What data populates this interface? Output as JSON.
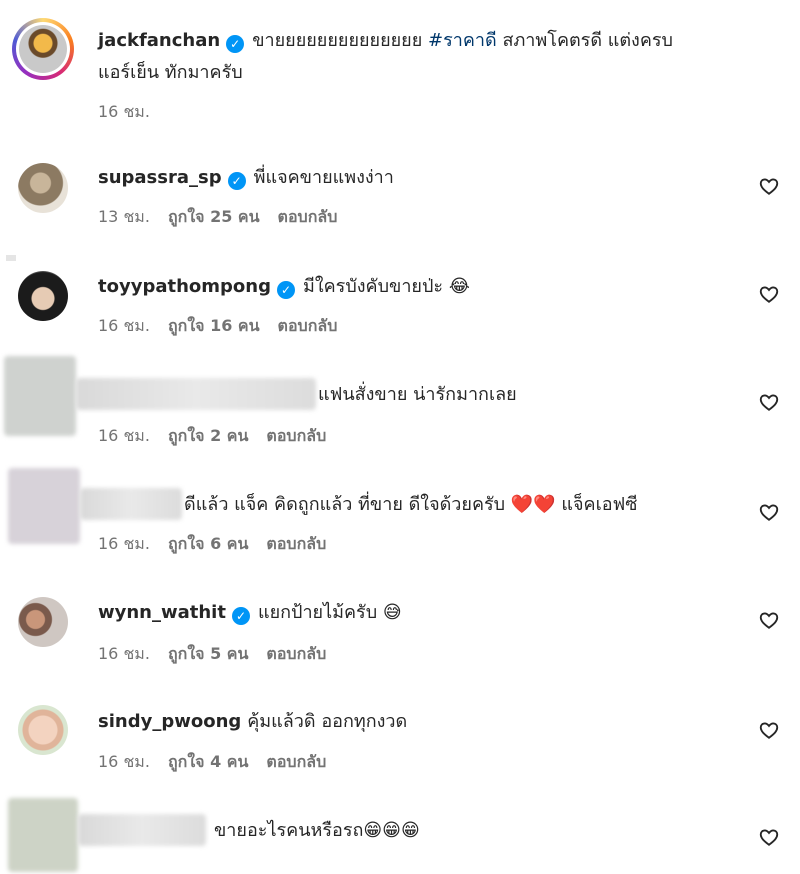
{
  "comments": [
    {
      "username": "jackfanchan",
      "verified": true,
      "text_before_hashtag": "ขายยยยยยยยยยยยยย",
      "hashtag": "#ราคาดี",
      "text_after_hashtag": "สภาพโคตรดี แต่งครบ",
      "text_line2": "แอร์เย็น ทักมาครับ",
      "time": "16 ชม."
    },
    {
      "username": "supassra_sp",
      "verified": true,
      "text": "พี่แจคขายแพงง่าา",
      "time": "13 ชม.",
      "likes": "ถูกใจ 25 คน",
      "reply": "ตอบกลับ"
    },
    {
      "username": "toyypathompong",
      "verified": true,
      "text": "มีใครบังคับขายป่ะ",
      "emoji": "😂",
      "time": "16 ชม.",
      "likes": "ถูกใจ 16 คน",
      "reply": "ตอบกลับ"
    },
    {
      "username": "",
      "text": "แฟนสั่งขาย น่ารักมากเลย",
      "time": "16 ชม.",
      "likes": "ถูกใจ 2 คน",
      "reply": "ตอบกลับ"
    },
    {
      "username": "",
      "text": "ดีแล้ว แจ็ค คิดถูกแล้ว ที่ขาย ดีใจด้วยครับ",
      "emoji": "❤️❤️",
      "text_after": "แจ็คเอฟซี",
      "time": "16 ชม.",
      "likes": "ถูกใจ 6 คน",
      "reply": "ตอบกลับ"
    },
    {
      "username": "wynn_wathit",
      "verified": true,
      "text": "แยกป้ายไม้ครับ",
      "emoji": "😅",
      "time": "16 ชม.",
      "likes": "ถูกใจ 5 คน",
      "reply": "ตอบกลับ"
    },
    {
      "username": "sindy_pwoong",
      "verified": false,
      "text": "คุ้มแล้วดิ ออกทุกงวด",
      "time": "16 ชม.",
      "likes": "ถูกใจ 4 คน",
      "reply": "ตอบกลับ"
    },
    {
      "username": "",
      "text": "ขายอะไรคนหรือรถ",
      "emoji": "😁😁😁"
    }
  ],
  "icons": {
    "verified": "✓",
    "like": "heart-outline-icon"
  },
  "colors": {
    "verified_badge": "#0095f6",
    "hashtag": "#00376b",
    "meta_text": "#737373"
  }
}
